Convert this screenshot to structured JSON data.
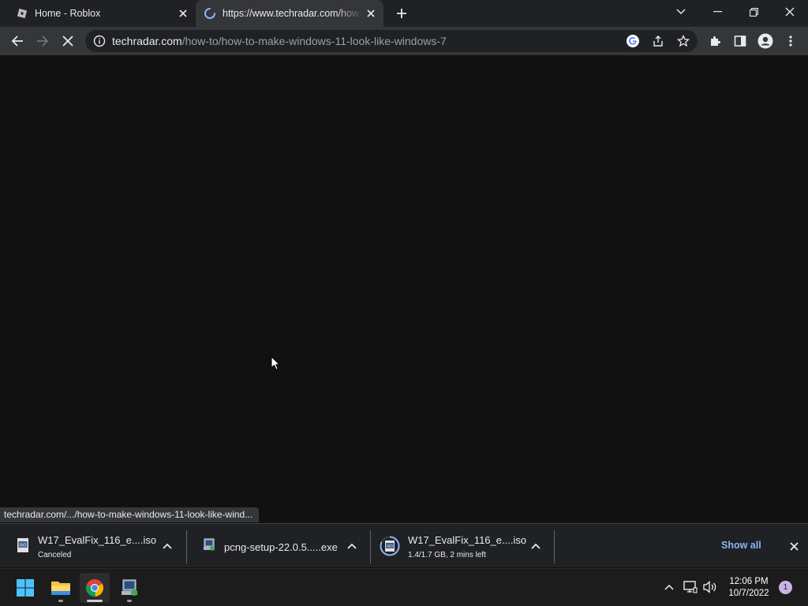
{
  "browser": {
    "tabs": [
      {
        "title": "Home - Roblox",
        "favicon": "roblox-icon",
        "active": false
      },
      {
        "title": "https://www.techradar.com/how-to/how-to-make-windows-11-look-like-windows-7",
        "favicon": "loading-spinner-icon",
        "active": true
      }
    ],
    "address": {
      "host": "techradar.com",
      "path": "/how-to/how-to-make-windows-11-look-like-windows-7"
    },
    "status_url": "techradar.com/.../how-to-make-windows-11-look-like-wind..."
  },
  "downloads": {
    "items": [
      {
        "name": "W17_EvalFix_116_e....iso",
        "status": "Canceled",
        "icon": "iso-file-icon"
      },
      {
        "name": "pcng-setup-22.0.5.....exe",
        "status": "",
        "icon": "installer-file-icon"
      },
      {
        "name": "W17_EvalFix_116_e....iso",
        "status": "1.4/1.7 GB, 2 mins left",
        "icon": "iso-file-icon",
        "progress": 0.82
      }
    ],
    "show_all_label": "Show all"
  },
  "taskbar": {
    "apps": [
      "start-icon",
      "file-explorer-icon",
      "chrome-icon",
      "installer-app-icon"
    ],
    "time": "12:06 PM",
    "date": "10/7/2022",
    "notification_count": "1"
  },
  "colors": {
    "page_bg": "#111112",
    "tabstrip_bg": "#202124",
    "toolbar_bg": "#35363a",
    "link_accent": "#8ab4f8"
  }
}
